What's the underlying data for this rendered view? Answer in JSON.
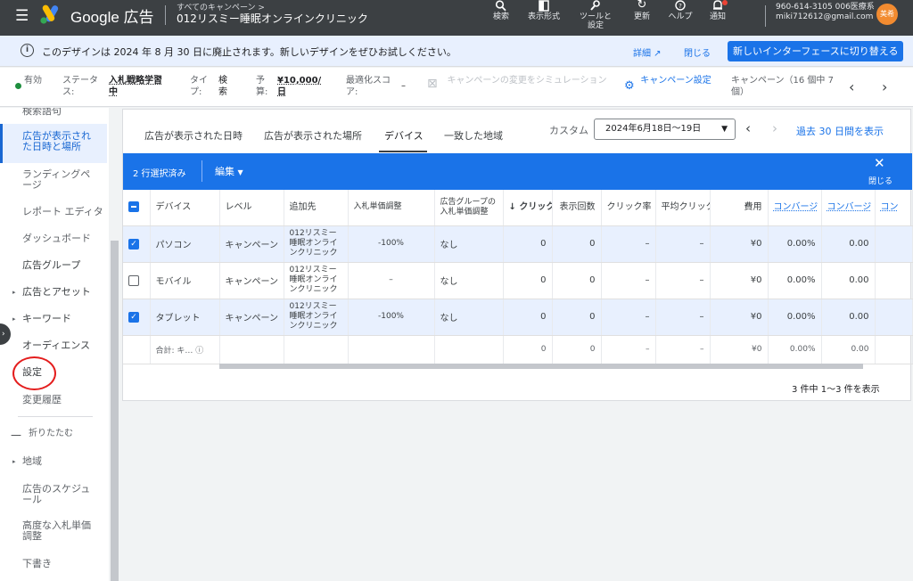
{
  "topbar": {
    "brand": "Google 広告",
    "breadcrumb": "すべてのキャンペーン >",
    "campaign": "012リスミー睡眠オンラインクリニック",
    "tools": [
      {
        "label": "検索",
        "icon": "search-icon"
      },
      {
        "label": "表示形式",
        "icon": "appearance-icon"
      },
      {
        "label": "ツールと設定",
        "icon": "tools-icon"
      },
      {
        "label": "更新",
        "icon": "refresh-icon"
      },
      {
        "label": "ヘルプ",
        "icon": "help-icon"
      },
      {
        "label": "通知",
        "icon": "bell-icon"
      }
    ],
    "account_id": "960-614-3105 006医療系",
    "account_email": "miki712612@gmail.com",
    "avatar_text": "美希"
  },
  "banner": {
    "message": "このデザインは 2024 年 8 月 30 日に廃止されます。新しいデザインをぜひお試しください。",
    "detail": "詳細 ↗",
    "close": "閉じる",
    "switch": "新しいインターフェースに切り替える"
  },
  "strip": {
    "status_label": "ステータス:",
    "status_value": "有効",
    "strategy": "入札戦略学習中",
    "type_label": "タイプ:",
    "type_value": "検索",
    "budget_label": "予算:",
    "budget_value": "¥10,000/日",
    "score_label": "最適化スコア:",
    "score_value": "–",
    "simulate": "キャンペーンの変更をシミュレーション",
    "campaign_settings": "キャンペーン設定",
    "campaign_count": "キャンペーン（16 個中 7 個）"
  },
  "sidebar": {
    "items": [
      {
        "label": "検索語句",
        "top": 0
      },
      {
        "label": "広告が表示された日時と場所",
        "active": true
      },
      {
        "label": "ランディングページ"
      },
      {
        "label": "レポート エディタ"
      },
      {
        "label": "ダッシュボード"
      },
      {
        "label": "広告グループ"
      },
      {
        "label": "広告とアセット"
      },
      {
        "label": "キーワード"
      },
      {
        "label": "オーディエンス"
      },
      {
        "label": "設定"
      },
      {
        "label": "変更履歴"
      },
      {
        "label": "折りたたむ"
      },
      {
        "label": "地域"
      },
      {
        "label": "広告のスケジュール"
      },
      {
        "label": "高度な入札単価調整"
      },
      {
        "label": "下書き"
      }
    ]
  },
  "tabs": [
    {
      "label": "広告が表示された日時"
    },
    {
      "label": "広告が表示された場所"
    },
    {
      "label": "デバイス"
    },
    {
      "label": "一致した地域"
    }
  ],
  "date": {
    "label": "カスタム",
    "range": "2024年6月18日～19日",
    "last30": "過去 30 日間を表示"
  },
  "selection": {
    "count": "2 行選択済み",
    "edit": "編集",
    "close": "閉じる"
  },
  "table": {
    "headers": [
      "デバイス",
      "レベル",
      "追加先",
      "入札単価調整",
      "広告グループの入札単価調整",
      "↓ クリック",
      "表示回数",
      "クリック率",
      "平均クリック",
      "費用",
      "コンバージ",
      "コンバージ",
      "コン"
    ],
    "rows": [
      {
        "selected": true,
        "cells": [
          "パソコン",
          "キャンペーン",
          "012リスミー睡眠オンラインクリニック",
          "-100%",
          "なし",
          "0",
          "0",
          "–",
          "–",
          "¥0",
          "0.00%",
          "0.00",
          ""
        ]
      },
      {
        "selected": false,
        "cells": [
          "モバイル",
          "キャンペーン",
          "012リスミー睡眠オンラインクリニック",
          "–",
          "なし",
          "0",
          "0",
          "–",
          "–",
          "¥0",
          "0.00%",
          "0.00",
          ""
        ]
      },
      {
        "selected": true,
        "cells": [
          "タブレット",
          "キャンペーン",
          "012リスミー睡眠オンラインクリニック",
          "-100%",
          "なし",
          "0",
          "0",
          "–",
          "–",
          "¥0",
          "0.00%",
          "0.00",
          ""
        ]
      }
    ],
    "total": [
      "合計: キ…",
      "",
      "",
      "",
      "",
      "0",
      "0",
      "–",
      "–",
      "¥0",
      "0.00%",
      "0.00",
      ""
    ],
    "footer": "3 件中 1～3 件を表示"
  },
  "colors": {
    "topbar": "#3c4043",
    "accent": "#1a73e8",
    "active_status": "#1e8e3e",
    "avatar": "#f28b30",
    "annotation_circle": "#e41d1d"
  }
}
